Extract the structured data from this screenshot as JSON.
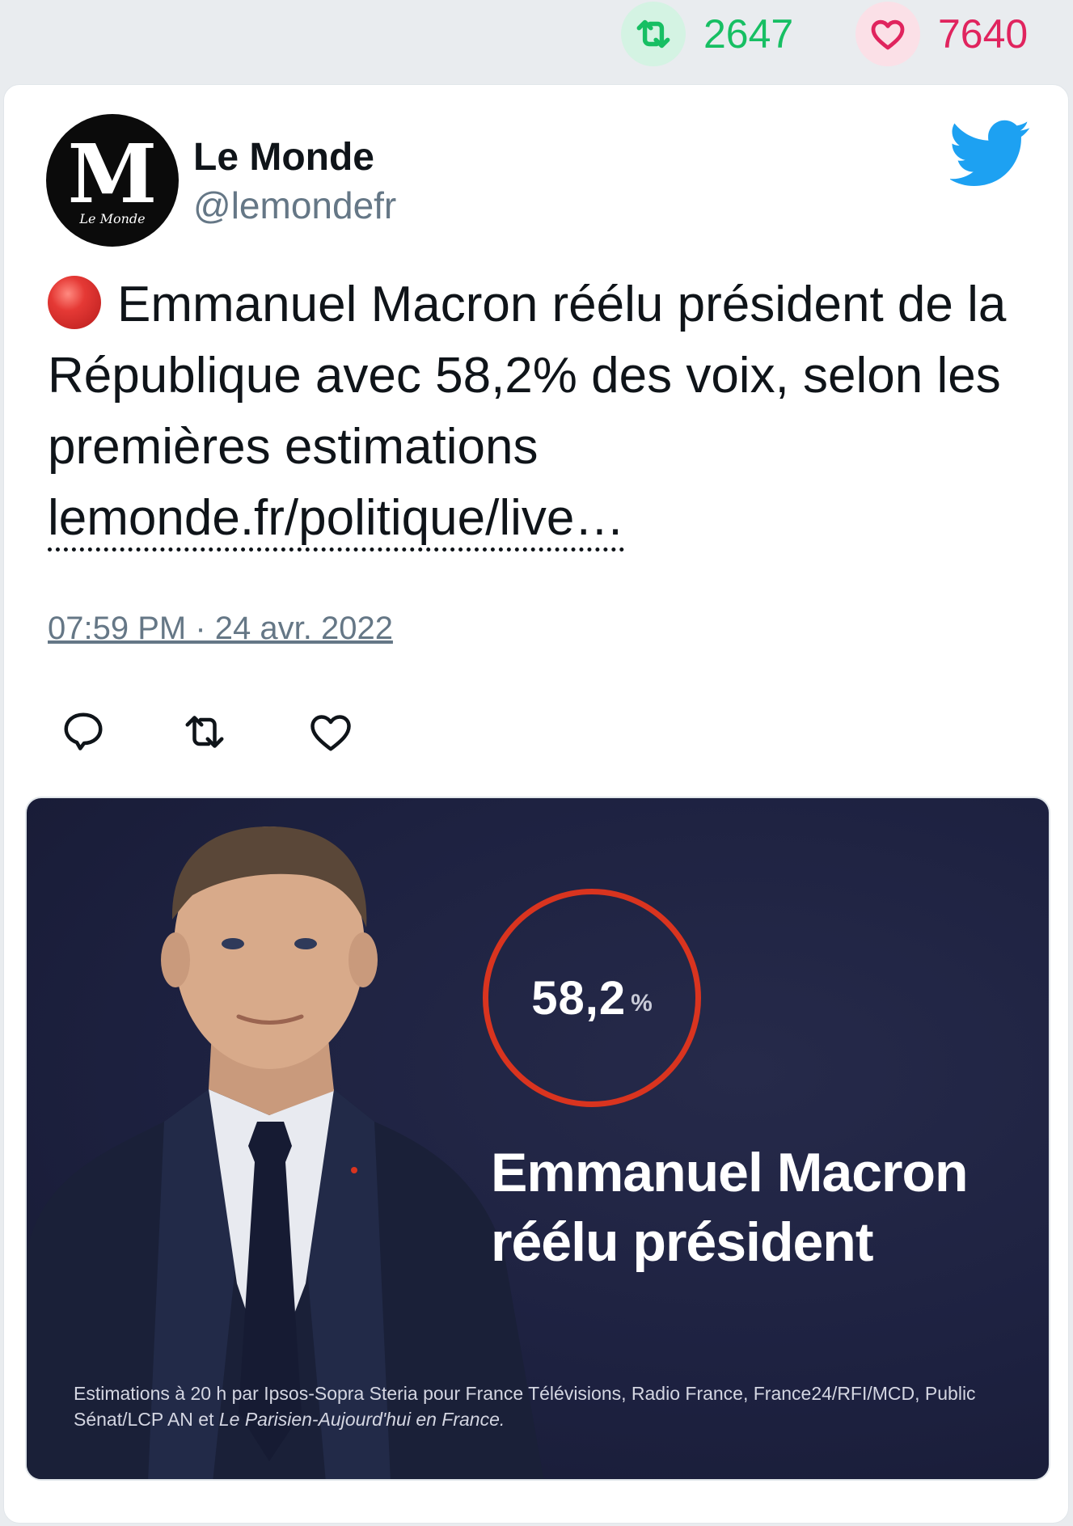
{
  "stats": {
    "retweets": "2647",
    "likes": "7640"
  },
  "tweet": {
    "author_name": "Le Monde",
    "author_handle": "@lemondefr",
    "avatar_letter": "M",
    "avatar_wordmark": "Le Monde",
    "text": "Emmanuel Macron réélu président de la République avec 58,2% des voix, selon les premières estimations",
    "link": "lemonde.fr/politique/live…",
    "timestamp": "07:59 PM · 24 avr. 2022"
  },
  "media": {
    "percent_value": "58,2",
    "percent_sign": "%",
    "headline_line1": "Emmanuel Macron",
    "headline_line2": "réélu président",
    "caption_part1": "Estimations à 20 h par Ipsos-Sopra Steria pour France Télévisions, Radio France, France24/RFI/MCD, Public Sénat/LCP AN et",
    "caption_italic": "Le Parisien-Aujourd'hui en France."
  },
  "icons": {
    "retweet": "retweet-icon",
    "like": "heart-icon",
    "reply": "reply-icon",
    "brand": "twitter-bird-icon",
    "live": "red-circle-icon"
  },
  "colors": {
    "retweet": "#17bf63",
    "like": "#e0245e",
    "twitter_blue": "#1da1f2",
    "ring": "#d9341f",
    "media_bg": "#1d2140"
  }
}
